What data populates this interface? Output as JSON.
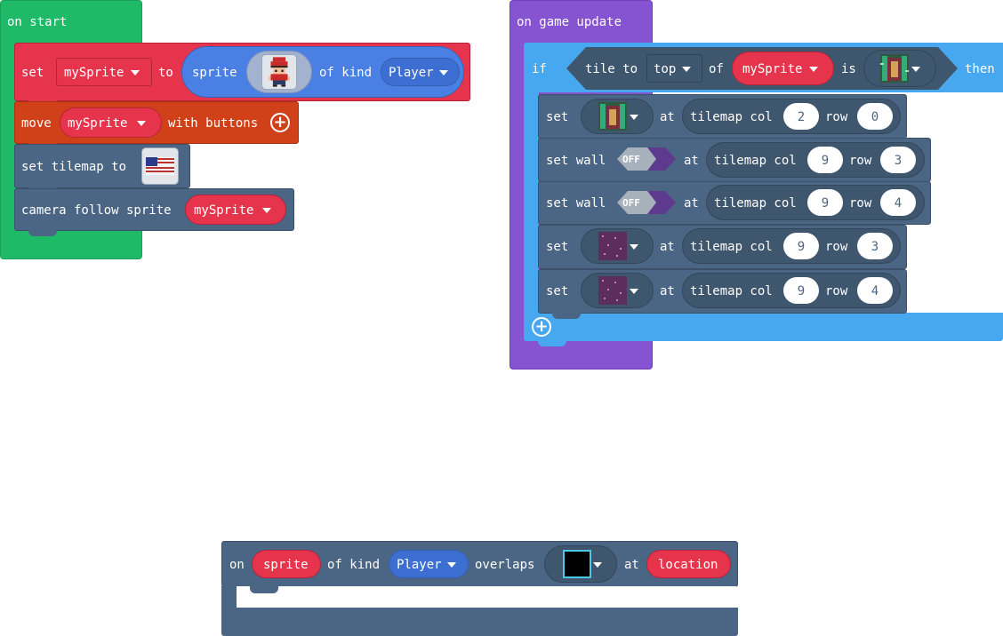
{
  "colors": {
    "events_green": "#1fba68",
    "game_purple": "#8654d0",
    "sprites_red": "#e5344b",
    "controller_orange": "#d0411a",
    "scene_slate": "#4b6584",
    "logic_blue": "#48a8ef",
    "kind_blue": "#4a80e3"
  },
  "on_start": {
    "hat_label": "on start",
    "set_block": {
      "label_set": "set",
      "var": "mySprite",
      "label_to": "to",
      "label_sprite": "sprite",
      "label_of_kind": "of kind",
      "kind": "Player"
    },
    "move_block": {
      "label_move": "move",
      "var": "mySprite",
      "label_with": "with buttons"
    },
    "tilemap_block": {
      "label": "set tilemap to"
    },
    "camera_block": {
      "label": "camera follow sprite",
      "var": "mySprite"
    }
  },
  "on_game_update": {
    "hat_label": "on game update",
    "if_block": {
      "label_if": "if",
      "label_tile_to": "tile to",
      "direction": "top",
      "label_of": "of",
      "var": "mySprite",
      "label_is": "is",
      "label_then": "then"
    },
    "statements": [
      {
        "label_set": "set",
        "label_at": "at",
        "label_tilemap_col": "tilemap col",
        "col": "2",
        "label_row": "row",
        "row": "0"
      },
      {
        "label_set": "set wall",
        "toggle": "OFF",
        "label_at": "at",
        "label_tilemap_col": "tilemap col",
        "col": "9",
        "label_row": "row",
        "row": "3"
      },
      {
        "label_set": "set wall",
        "toggle": "OFF",
        "label_at": "at",
        "label_tilemap_col": "tilemap col",
        "col": "9",
        "label_row": "row",
        "row": "4"
      },
      {
        "label_set": "set",
        "label_at": "at",
        "label_tilemap_col": "tilemap col",
        "col": "9",
        "label_row": "row",
        "row": "3"
      },
      {
        "label_set": "set",
        "label_at": "at",
        "label_tilemap_col": "tilemap col",
        "col": "9",
        "label_row": "row",
        "row": "4"
      }
    ]
  },
  "on_overlap": {
    "label_on": "on",
    "sprite": "sprite",
    "label_of_kind": "of kind",
    "kind": "Player",
    "label_overlaps": "overlaps",
    "label_at": "at",
    "location": "location"
  },
  "icons": {
    "plus": "plus-circle-icon",
    "caret": "caret-down-icon"
  }
}
